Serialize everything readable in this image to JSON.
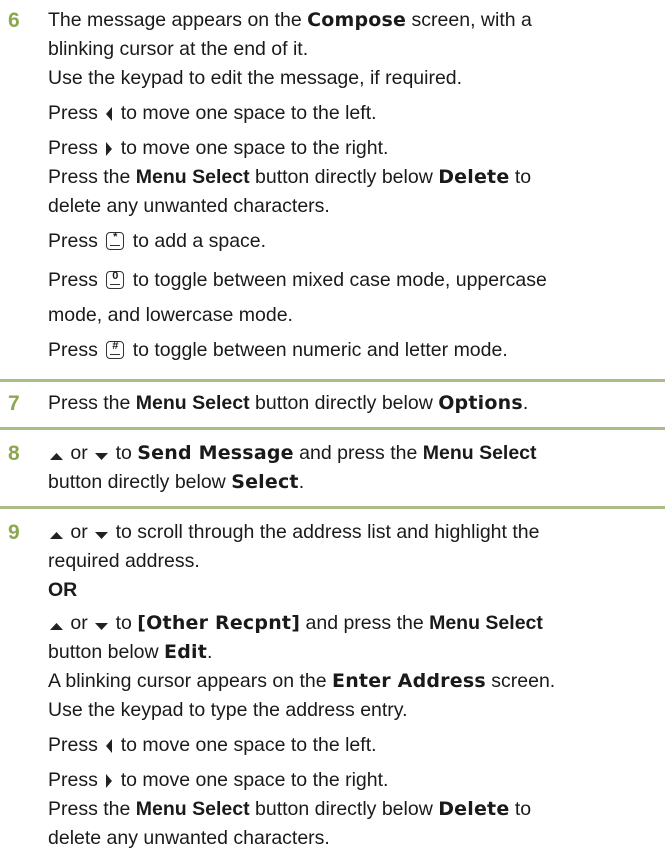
{
  "steps": [
    {
      "number": "6",
      "lines": [
        [
          "The message appears on the ",
          "Compose",
          " screen, with a"
        ],
        [
          "blinking cursor at the end of it."
        ],
        [
          "Use the keypad to edit the message, if required."
        ],
        [
          "Press",
          "to move one space to the left."
        ],
        [
          "Press",
          "to move one space to the right."
        ],
        [
          "Press the ",
          "Menu Select",
          " button directly below ",
          "Delete",
          " to"
        ],
        [
          "delete any unwanted characters."
        ],
        [
          "Press",
          "to add a space."
        ],
        [
          "Press",
          "to toggle between mixed case mode, uppercase"
        ],
        [
          "mode, and lowercase mode."
        ],
        [
          "Press",
          "to toggle between numeric and letter mode."
        ]
      ]
    },
    {
      "number": "7",
      "lines": [
        [
          "Press the ",
          "Menu Select",
          " button directly below ",
          "Options",
          "."
        ]
      ]
    },
    {
      "number": "8",
      "lines": [
        [
          "or",
          "to ",
          "Send Message",
          " and press the ",
          "Menu Select"
        ],
        [
          "button directly below ",
          "Select",
          "."
        ]
      ]
    },
    {
      "number": "9",
      "lines": [
        [
          "or",
          "to scroll through the address list and highlight the"
        ],
        [
          "required address."
        ],
        [
          "OR"
        ],
        [
          "or",
          "to ",
          "[Other Recpnt]",
          " and press the ",
          "Menu Select"
        ],
        [
          "button below ",
          "Edit",
          "."
        ],
        [
          "A blinking cursor appears on the ",
          "Enter Address",
          " screen."
        ],
        [
          "Use the keypad to type the address entry."
        ],
        [
          "Press",
          "to move one space to the left."
        ],
        [
          "Press",
          "to move one space to the right."
        ],
        [
          "Press the ",
          "Menu Select",
          " button directly below ",
          "Delete",
          " to"
        ],
        [
          "delete any unwanted characters."
        ]
      ]
    }
  ],
  "icons": {
    "left": "left-arrow-icon",
    "right": "right-arrow-icon",
    "up": "up-arrow-icon",
    "down": "down-arrow-icon",
    "star_key": "star-key-icon",
    "zero_key": "zero-key-icon",
    "hash_key": "hash-key-icon"
  },
  "colors": {
    "step_number": "#8aa84f",
    "rule": "#a9bd84"
  }
}
